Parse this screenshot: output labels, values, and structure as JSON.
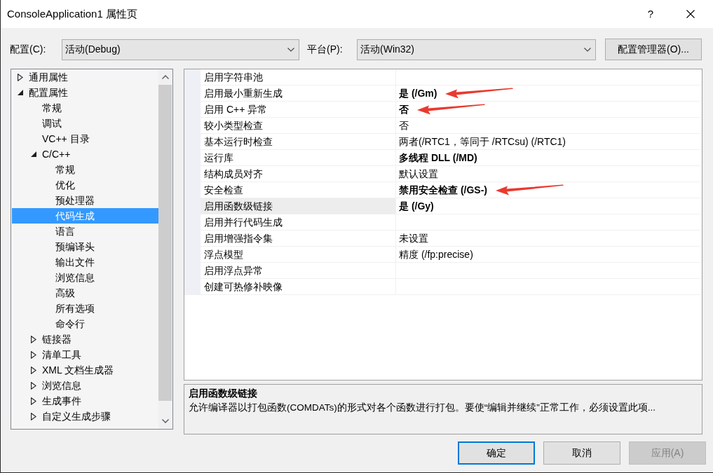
{
  "window": {
    "title": "ConsoleApplication1 属性页",
    "help": "?"
  },
  "config_bar": {
    "configuration": {
      "label": "配置(C):",
      "value": "活动(Debug)"
    },
    "platform": {
      "label": "平台(P):",
      "value": "活动(Win32)"
    },
    "manager_button": "配置管理器(O)..."
  },
  "tree": [
    {
      "label": "通用属性",
      "kind": "group",
      "expanded": false,
      "selected": false
    },
    {
      "label": "配置属性",
      "kind": "group",
      "expanded": true,
      "selected": false,
      "children": [
        {
          "label": "常规",
          "kind": "leaf",
          "selected": false
        },
        {
          "label": "调试",
          "kind": "leaf",
          "selected": false
        },
        {
          "label": "VC++ 目录",
          "kind": "leaf",
          "selected": false
        },
        {
          "label": "C/C++",
          "kind": "group",
          "expanded": true,
          "selected": false,
          "children": [
            {
              "label": "常规",
              "kind": "leaf",
              "selected": false
            },
            {
              "label": "优化",
              "kind": "leaf",
              "selected": false
            },
            {
              "label": "预处理器",
              "kind": "leaf",
              "selected": false
            },
            {
              "label": "代码生成",
              "kind": "leaf",
              "selected": true
            },
            {
              "label": "语言",
              "kind": "leaf",
              "selected": false
            },
            {
              "label": "预编译头",
              "kind": "leaf",
              "selected": false
            },
            {
              "label": "输出文件",
              "kind": "leaf",
              "selected": false
            },
            {
              "label": "浏览信息",
              "kind": "leaf",
              "selected": false
            },
            {
              "label": "高级",
              "kind": "leaf",
              "selected": false
            },
            {
              "label": "所有选项",
              "kind": "leaf",
              "selected": false
            },
            {
              "label": "命令行",
              "kind": "leaf",
              "selected": false
            }
          ]
        },
        {
          "label": "链接器",
          "kind": "group",
          "expanded": false,
          "selected": false
        },
        {
          "label": "清单工具",
          "kind": "group",
          "expanded": false,
          "selected": false
        },
        {
          "label": "XML 文档生成器",
          "kind": "group",
          "expanded": false,
          "selected": false
        },
        {
          "label": "浏览信息",
          "kind": "group",
          "expanded": false,
          "selected": false
        },
        {
          "label": "生成事件",
          "kind": "group",
          "expanded": false,
          "selected": false
        },
        {
          "label": "自定义生成步骤",
          "kind": "group",
          "expanded": false,
          "selected": false
        }
      ]
    }
  ],
  "properties": [
    {
      "name": "启用字符串池",
      "selected": false,
      "annotated": false
    },
    {
      "name": "启用最小重新生成",
      "value": "是 (/Gm)",
      "modified": true,
      "selected": false,
      "annotated": true
    },
    {
      "name": "启用 C++ 异常",
      "value": "否",
      "modified": true,
      "selected": false,
      "annotated": true
    },
    {
      "name": "较小类型检查",
      "value": "否",
      "modified": false,
      "selected": false,
      "annotated": false
    },
    {
      "name": "基本运行时检查",
      "value": "两者(/RTC1，等同于 /RTCsu) (/RTC1)",
      "modified": false,
      "selected": false,
      "annotated": false
    },
    {
      "name": "运行库",
      "value": "多线程 DLL (/MD)",
      "modified": true,
      "selected": false,
      "annotated": false
    },
    {
      "name": "结构成员对齐",
      "value": "默认设置",
      "modified": false,
      "selected": false,
      "annotated": false
    },
    {
      "name": "安全检查",
      "value": "禁用安全检查 (/GS-)",
      "modified": true,
      "selected": false,
      "annotated": true
    },
    {
      "name": "启用函数级链接",
      "value": "是 (/Gy)",
      "modified": true,
      "selected": true,
      "annotated": false
    },
    {
      "name": "启用并行代码生成",
      "selected": false,
      "annotated": false
    },
    {
      "name": "启用增强指令集",
      "value": "未设置",
      "modified": false,
      "selected": false,
      "annotated": false
    },
    {
      "name": "浮点模型",
      "value": "精度 (/fp:precise)",
      "modified": false,
      "selected": false,
      "annotated": false
    },
    {
      "name": "启用浮点异常",
      "selected": false,
      "annotated": false
    },
    {
      "name": "创建可热修补映像",
      "selected": false,
      "annotated": false
    }
  ],
  "description": {
    "title": "启用函数级链接",
    "text": "允许编译器以打包函数(COMDATs)的形式对各个函数进行打包。要使“编辑并继续”正常工作，必须设置此项..."
  },
  "buttons": [
    {
      "label": "确定",
      "default": true,
      "disabled": false
    },
    {
      "label": "取消",
      "default": false,
      "disabled": false
    },
    {
      "label": "应用(A)",
      "default": false,
      "disabled": true
    }
  ]
}
